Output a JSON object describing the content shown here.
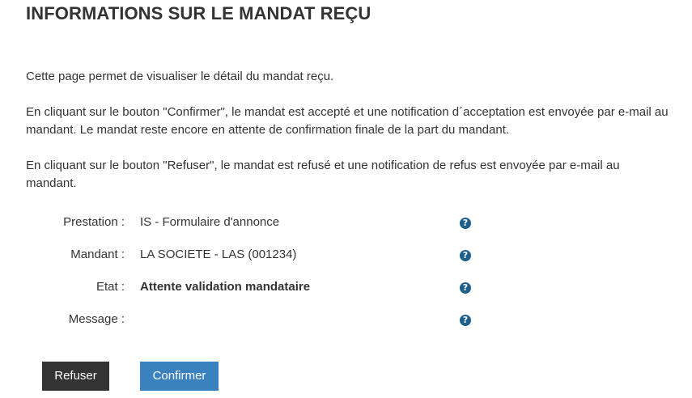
{
  "page": {
    "title": "INFORMATIONS SUR LE MANDAT REÇU"
  },
  "intro": {
    "p1": "Cette page permet de visualiser le détail du mandat reçu.",
    "p2": "En cliquant sur le bouton \"Confirmer\", le mandat est accepté et une notification d´acceptation est envoyée par e-mail au mandant. Le mandat reste encore en attente de confirmation finale de la part du mandant.",
    "p3": "En cliquant sur le bouton \"Refuser\", le mandat est refusé et une notification de refus est envoyée par e-mail au mandant."
  },
  "details": {
    "prestation": {
      "label": "Prestation :",
      "value": "IS - Formulaire d'annonce"
    },
    "mandant": {
      "label": "Mandant :",
      "value": "LA SOCIETE - LAS (001234)"
    },
    "etat": {
      "label": "Etat :",
      "value": "Attente validation mandataire"
    },
    "message": {
      "label": "Message :",
      "value": ""
    },
    "help_glyph": "?"
  },
  "actions": {
    "refuse_label": "Refuser",
    "confirm_label": "Confirmer"
  },
  "colors": {
    "refuse_bg": "#333333",
    "confirm_bg": "#3a81c0",
    "help_icon": "#1f5f8b"
  },
  "icons": {
    "help": "question-circle-icon"
  }
}
